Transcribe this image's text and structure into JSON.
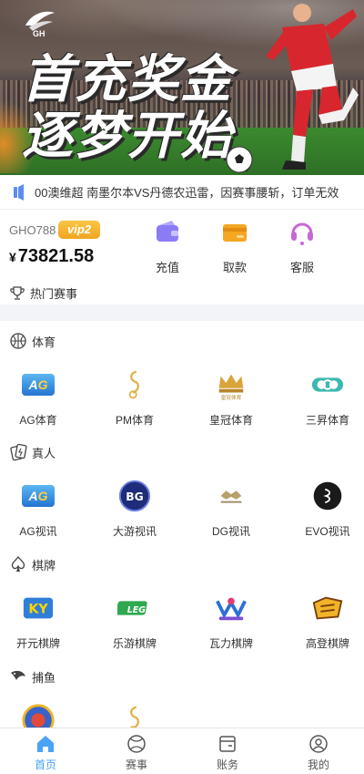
{
  "banner": {
    "logo_text": "GH",
    "line1": "首充奖金",
    "line2": "逐梦开始"
  },
  "notice": {
    "text": "00澳维超 南墨尔本VS丹德农迅雷，因赛事腰斩，订单无效"
  },
  "account": {
    "user_id": "GHO788",
    "vip_label": "vip2",
    "currency": "¥",
    "balance": "73821.58",
    "actions": [
      {
        "label": "充值",
        "icon": "wallet-icon"
      },
      {
        "label": "取款",
        "icon": "card-icon"
      },
      {
        "label": "客服",
        "icon": "headset-icon"
      }
    ],
    "hot_label": "热门赛事"
  },
  "categories": [
    {
      "title": "体育",
      "icon": "basketball-icon",
      "games": [
        {
          "label": "AG体育",
          "icon": "ag-logo"
        },
        {
          "label": "PM体育",
          "icon": "pm-logo"
        },
        {
          "label": "皇冠体育",
          "icon": "crown-logo",
          "logo_text": "皇冠体育"
        },
        {
          "label": "三昇体育",
          "icon": "sansheng-logo"
        }
      ]
    },
    {
      "title": "真人",
      "icon": "card-game-icon",
      "games": [
        {
          "label": "AG视讯",
          "icon": "ag-logo"
        },
        {
          "label": "大游视讯",
          "icon": "bg-logo",
          "logo_text": "BG"
        },
        {
          "label": "DG视讯",
          "icon": "dg-logo"
        },
        {
          "label": "EVO视讯",
          "icon": "evo-logo"
        }
      ]
    },
    {
      "title": "棋牌",
      "icon": "spade-icon",
      "games": [
        {
          "label": "开元棋牌",
          "icon": "ky-logo",
          "logo_text": "KY"
        },
        {
          "label": "乐游棋牌",
          "icon": "leg-logo",
          "logo_text": "LEG"
        },
        {
          "label": "瓦力棋牌",
          "icon": "wali-logo"
        },
        {
          "label": "高登棋牌",
          "icon": "gaodeng-logo"
        }
      ]
    },
    {
      "title": "捕鱼",
      "icon": "fish-icon",
      "games": [
        {
          "label": "",
          "icon": "fish-game-logo"
        },
        {
          "label": "",
          "icon": "pm-logo"
        }
      ]
    }
  ],
  "ag_text": {
    "a": "A",
    "g": "G"
  },
  "tabbar": {
    "tabs": [
      {
        "label": "首页",
        "icon": "home-icon",
        "active": true
      },
      {
        "label": "赛事",
        "icon": "ball-icon",
        "active": false
      },
      {
        "label": "账务",
        "icon": "ledger-icon",
        "active": false
      },
      {
        "label": "我的",
        "icon": "profile-icon",
        "active": false
      }
    ]
  },
  "colors": {
    "accent": "#4aa3f5",
    "vip": "#f0a51f",
    "wallet": "#8b7cf6",
    "card": "#f5a623",
    "headset": "#c768d6"
  }
}
